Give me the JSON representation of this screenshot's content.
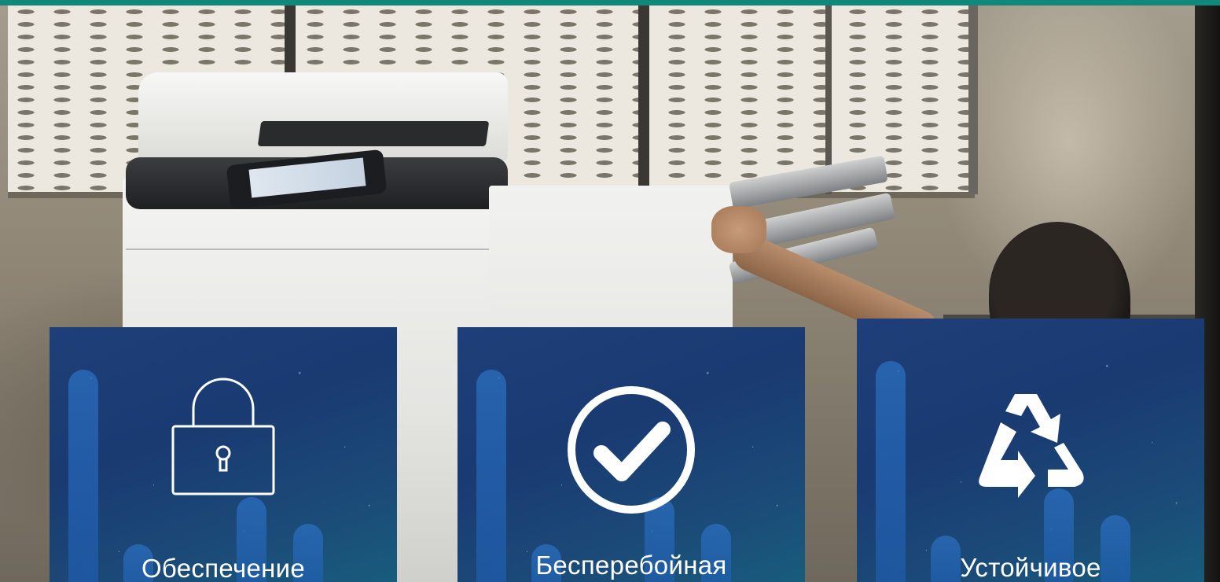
{
  "hero": {
    "accent_color": "#11897a",
    "card_bg_color": "#1f3f7a"
  },
  "cards": [
    {
      "label": "Обеспечение",
      "icon": "padlock-icon"
    },
    {
      "label": "Бесперебойная",
      "icon": "checkmark-circle-icon"
    },
    {
      "label": "Устойчивое",
      "icon": "recycle-icon"
    }
  ]
}
